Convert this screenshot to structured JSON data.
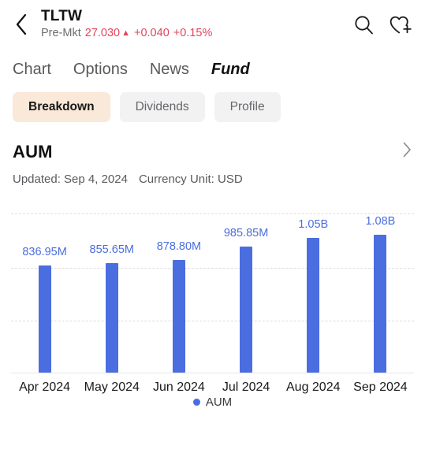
{
  "header": {
    "back_icon": "chevron-left-icon",
    "ticker": "TLTW",
    "session_label": "Pre-Mkt",
    "price": "27.030",
    "arrow": "▲",
    "change": "+0.040",
    "change_pct": "+0.15%",
    "price_color": "#e2445c",
    "search_icon": "search-icon",
    "watchlist_icon": "heart-plus-icon"
  },
  "tabs": [
    {
      "label": "Chart",
      "active": false
    },
    {
      "label": "Options",
      "active": false
    },
    {
      "label": "News",
      "active": false
    },
    {
      "label": "Fund",
      "active": true
    }
  ],
  "pills": [
    {
      "label": "Breakdown",
      "active": true
    },
    {
      "label": "Dividends",
      "active": false
    },
    {
      "label": "Profile",
      "active": false
    }
  ],
  "section": {
    "title": "AUM",
    "chevron_icon": "chevron-right-icon",
    "updated": "Updated: Sep 4, 2024",
    "currency_unit": "Currency Unit: USD"
  },
  "chart_data": {
    "type": "bar",
    "title": "AUM",
    "xlabel": "",
    "ylabel": "",
    "categories": [
      "Apr 2024",
      "May 2024",
      "Jun 2024",
      "Jul 2024",
      "Aug 2024",
      "Sep 2024"
    ],
    "values": [
      836950000,
      855650000,
      878800000,
      985850000,
      1050000000,
      1080000000
    ],
    "data_labels": [
      "836.95M",
      "855.65M",
      "878.80M",
      "985.85M",
      "1.05B",
      "1.08B"
    ],
    "series": [
      {
        "name": "AUM",
        "values": [
          836950000,
          855650000,
          878800000,
          985850000,
          1050000000,
          1080000000
        ],
        "color": "#4a6de0"
      }
    ],
    "ylim": [
      0,
      1250000000
    ],
    "grid": true,
    "gridlines": 3,
    "legend": [
      {
        "label": "AUM",
        "color": "#4a6de0"
      }
    ],
    "legend_position": "bottom",
    "bar_color": "#4a6de0",
    "label_color": "#4a6de0"
  }
}
